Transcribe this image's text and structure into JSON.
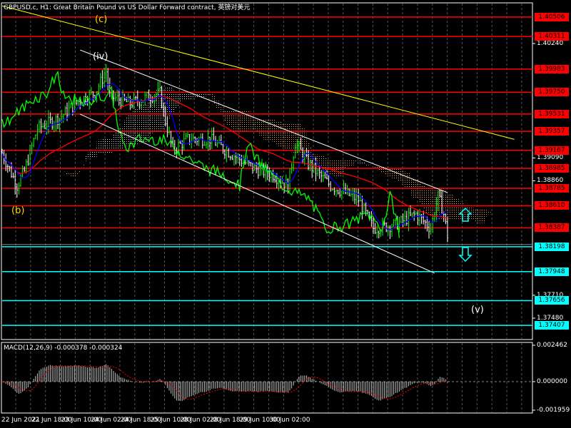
{
  "header": {
    "title": "GBPUSD.c, H1:  Great Britain Pound vs US Dollar Forward contract, 英镑对美元"
  },
  "colors": {
    "background": "#000000",
    "resistance": "#ff0000",
    "support": "#00ffff",
    "trendline": "#ffff00",
    "channel": "#ffffff",
    "bars": "#00ff00",
    "ma": "#ff0000",
    "ma_fast": "#0000ff"
  },
  "annotations": {
    "wave_c": "(c)",
    "wave_iv": "(iv)",
    "wave_b": "(b)",
    "wave_v": "(v)"
  },
  "price_axis": {
    "ticks": [
      "1.40240",
      "1.39090",
      "1.38860",
      "1.37710",
      "1.37480"
    ],
    "tick_values": [
      1.4024,
      1.3909,
      1.3886,
      1.3771,
      1.3748
    ],
    "current_price": 1.3822
  },
  "levels": {
    "resistance": [
      "1.40506",
      "1.40311",
      "1.39983",
      "1.39750",
      "1.39531",
      "1.39357",
      "1.39167",
      "1.38985",
      "1.38785",
      "1.38610",
      "1.38387"
    ],
    "support": [
      "1.38198",
      "1.37948",
      "1.37656",
      "1.37407"
    ]
  },
  "time_axis": {
    "labels": [
      "22 Jun 2021",
      "22 Jun 18:00",
      "23 Jun 10:00",
      "24 Jun 02:00",
      "24 Jun 18:00",
      "25 Jun 10:00",
      "28 Jun 02:00",
      "28 Jun 18:00",
      "29 Jun 10:00",
      "30 Jun 02:00"
    ]
  },
  "macd": {
    "title": "MACD(12,26,9) -0.000378 -0.000324",
    "axis": [
      "0.002462",
      "0.000000",
      "-0.001959"
    ],
    "axis_values": [
      0.002462,
      0.0,
      -0.001959
    ]
  },
  "chart_data": {
    "type": "line",
    "title": "GBPUSD.c H1",
    "price_path": {
      "bar": [
        0,
        8,
        12,
        19,
        31,
        42,
        50,
        56,
        58,
        69,
        85,
        88,
        92,
        100,
        112,
        123,
        135,
        146,
        154,
        158,
        165,
        177,
        192,
        200,
        212,
        223,
        231,
        235,
        238,
        240
      ],
      "price": [
        1.39136,
        1.38813,
        1.38957,
        1.39387,
        1.39494,
        1.39674,
        1.39745,
        1.3996,
        1.3971,
        1.39638,
        1.39745,
        1.39459,
        1.39172,
        1.39279,
        1.39279,
        1.39136,
        1.38993,
        1.38921,
        1.38813,
        1.39244,
        1.39028,
        1.38813,
        1.3867,
        1.38383,
        1.38419,
        1.38527,
        1.38383,
        1.38706,
        1.38527,
        1.38312
      ]
    },
    "trendline": {
      "from": {
        "bar": 0,
        "price": 1.40618
      },
      "to": {
        "bar": 276,
        "price": 1.39277
      }
    },
    "channel_upper": {
      "from": {
        "bar": 42,
        "price": 1.40175
      },
      "to": {
        "bar": 240,
        "price": 1.38742
      }
    },
    "channel_lower": {
      "from": {
        "bar": 42,
        "price": 1.3953
      },
      "to": {
        "bar": 233,
        "price": 1.37932
      }
    }
  }
}
